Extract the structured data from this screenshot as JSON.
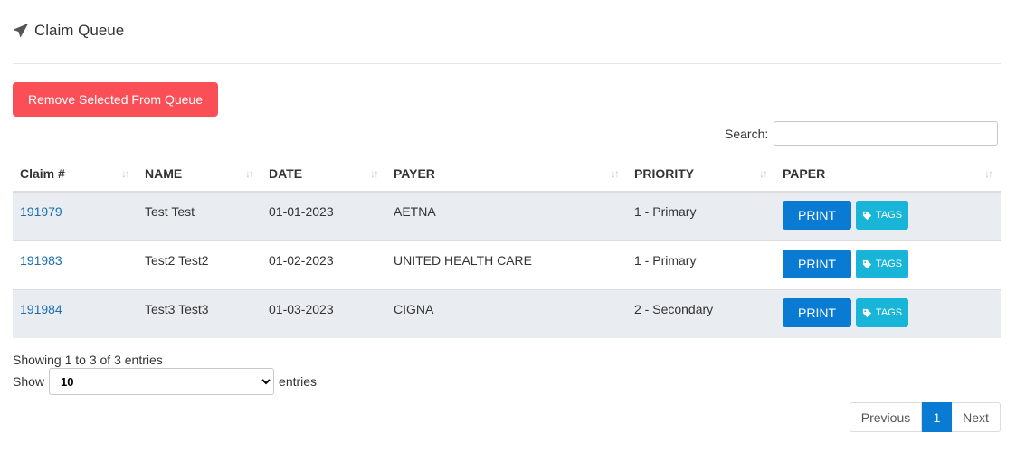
{
  "header": {
    "title": "Claim Queue",
    "icon": "paper-plane-icon"
  },
  "actions": {
    "remove_label": "Remove Selected From Queue",
    "remove_color": "#fb4f57"
  },
  "search": {
    "label": "Search:",
    "value": "",
    "placeholder": ""
  },
  "table": {
    "columns": [
      "Claim #",
      "NAME",
      "DATE",
      "PAYER",
      "PRIORITY",
      "PAPER"
    ],
    "rows": [
      {
        "claim": "191979",
        "name": "Test Test",
        "date": "01-01-2023",
        "payer": "AETNA",
        "priority": "1 - Primary",
        "print_label": "PRINT",
        "tags_label": "TAGS"
      },
      {
        "claim": "191983",
        "name": "Test2 Test2",
        "date": "01-02-2023",
        "payer": "UNITED HEALTH CARE",
        "priority": "1 - Primary",
        "print_label": "PRINT",
        "tags_label": "TAGS"
      },
      {
        "claim": "191984",
        "name": "Test3 Test3",
        "date": "01-03-2023",
        "payer": "CIGNA",
        "priority": "2 - Secondary",
        "print_label": "PRINT",
        "tags_label": "TAGS"
      }
    ]
  },
  "footer": {
    "info": "Showing 1 to 3 of 3 entries",
    "show_label": "Show",
    "page_size": "10",
    "entries_label": "entries"
  },
  "pagination": {
    "previous": "Previous",
    "current": "1",
    "next": "Next"
  },
  "colors": {
    "accent": "#0a7bd3",
    "tags": "#18b5d8",
    "link": "#1a6fb0",
    "stripe": "#e9ecf1"
  }
}
